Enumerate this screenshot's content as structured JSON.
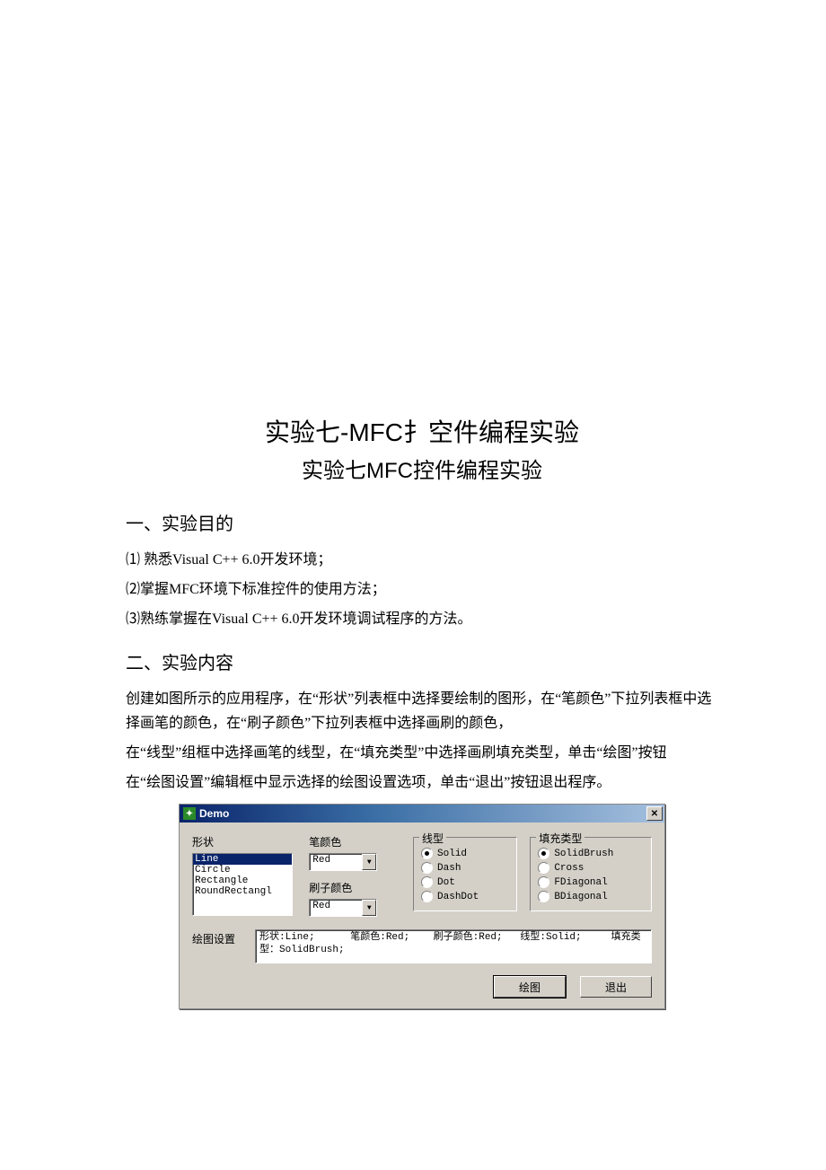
{
  "doc": {
    "title1": "实验七-MFC扌空件编程实验",
    "title2": "实验七MFC控件编程实验",
    "section1_head": "一、实验目的",
    "objectives": [
      "⑴ 熟悉Visual C++ 6.0开发环境；",
      "⑵掌握MFC环境下标准控件的使用方法；",
      "⑶熟练掌握在Visual C++ 6.0开发环境调试程序的方法。"
    ],
    "section2_head": "二、实验内容",
    "content_paras": [
      "创建如图所示的应用程序，在“形状”列表框中选择要绘制的图形，在“笔颜色”下拉列表框中选择画笔的颜色，在“刷子颜色”下拉列表框中选择画刷的颜色，",
      "在“线型”组框中选择画笔的线型，在“填充类型”中选择画刷填充类型，单击“绘图”按钮",
      "在“绘图设置”编辑框中显示选择的绘图设置选项，单击“退出”按钮退出程序。"
    ]
  },
  "dialog": {
    "title": "Demo",
    "labels": {
      "shape": "形状",
      "pen_color": "笔颜色",
      "brush_color": "刷子颜色",
      "line_type": "线型",
      "fill_type": "填充类型",
      "settings": "绘图设置"
    },
    "shapes": [
      "Line",
      "Circle",
      "Rectangle",
      "RoundRectangl"
    ],
    "shape_selected": "Line",
    "pen_color_value": "Red",
    "brush_color_value": "Red",
    "line_types": [
      {
        "label": "Solid",
        "checked": true
      },
      {
        "label": "Dash",
        "checked": false
      },
      {
        "label": "Dot",
        "checked": false
      },
      {
        "label": "DashDot",
        "checked": false
      }
    ],
    "fill_types": [
      {
        "label": "SolidBrush",
        "checked": true
      },
      {
        "label": "Cross",
        "checked": false
      },
      {
        "label": "FDiagonal",
        "checked": false
      },
      {
        "label": "BDiagonal",
        "checked": false
      }
    ],
    "settings_text": "形状:Line;      笔颜色:Red;    刷子颜色:Red;   线型:Solid;     填充类型：SolidBrush;",
    "buttons": {
      "draw": "绘图",
      "exit": "退出"
    }
  }
}
